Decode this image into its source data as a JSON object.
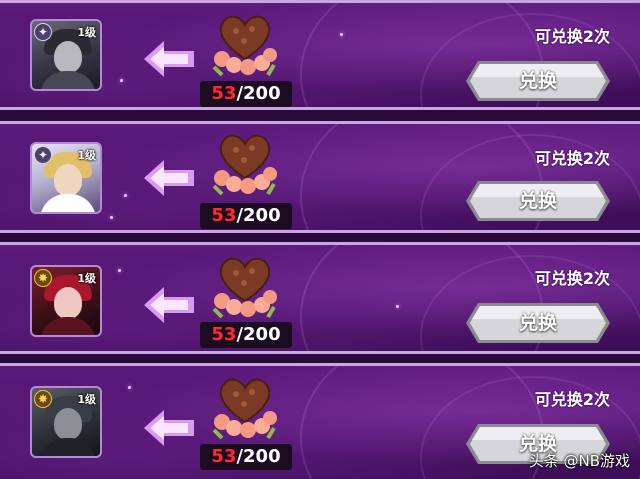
{
  "colors": {
    "panel": "#4a1266",
    "border": "#c9a6e0",
    "have_count": "#ff2a2a",
    "need_count": "#ffffff",
    "button": "#c8c8cc"
  },
  "exchange_rows": [
    {
      "level": "1级",
      "badge_icon": "star-badge-icon",
      "badge_glyph": "✦",
      "item_icon": "chocolate-heart-bouquet-icon",
      "have": "53",
      "need": "/200",
      "remaining": "可兑换2次",
      "button_label": "兑换"
    },
    {
      "level": "1级",
      "badge_icon": "star-badge-icon",
      "badge_glyph": "✦",
      "item_icon": "chocolate-heart-bouquet-icon",
      "have": "53",
      "need": "/200",
      "remaining": "可兑换2次",
      "button_label": "兑换"
    },
    {
      "level": "1级",
      "badge_icon": "gold-badge-icon",
      "badge_glyph": "✸",
      "item_icon": "chocolate-heart-bouquet-icon",
      "have": "53",
      "need": "/200",
      "remaining": "可兑换2次",
      "button_label": "兑换"
    },
    {
      "level": "1级",
      "badge_icon": "gold-badge-icon",
      "badge_glyph": "✸",
      "item_icon": "chocolate-heart-bouquet-icon",
      "have": "53",
      "need": "/200",
      "remaining": "可兑换2次",
      "button_label": "兑换"
    }
  ],
  "watermark": "头条 @NB游戏"
}
